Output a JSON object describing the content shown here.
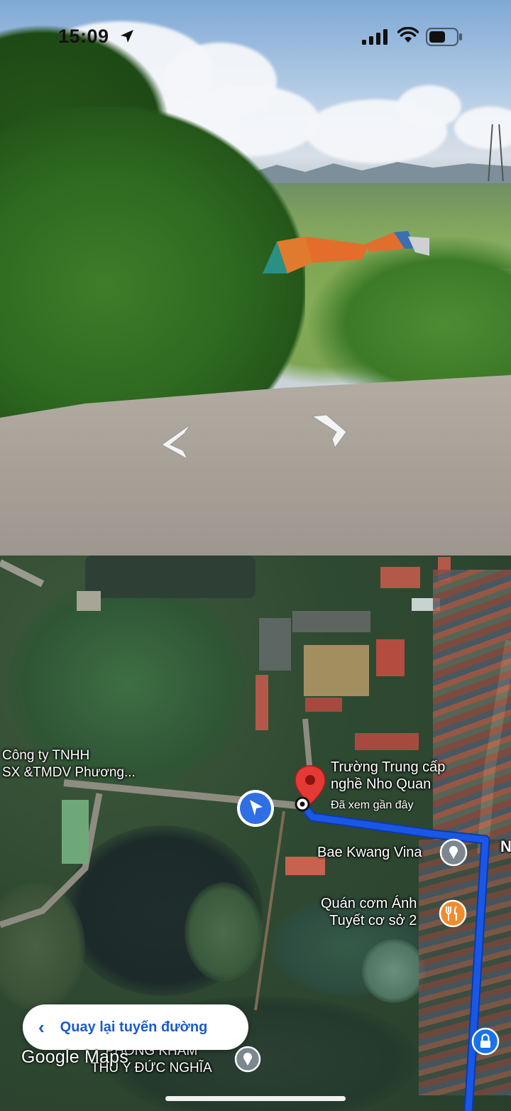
{
  "status_bar": {
    "time": "15:09",
    "icons": [
      "location-arrow-icon",
      "cellular-signal-icon",
      "wifi-icon",
      "battery-icon"
    ]
  },
  "street_view": {
    "controls": [
      "nav-arrow-back-icon",
      "nav-arrow-forward-icon"
    ]
  },
  "map": {
    "places": [
      {
        "name_line1": "Công ty TNHH",
        "name_line2": "SX &TMDV Phương..."
      },
      {
        "name_line1": "Trường Trung cấp",
        "name_line2": "nghề Nho Quan",
        "subtitle": "Đã xem gần đây"
      },
      {
        "name": "Bae Kwang Vina"
      },
      {
        "name_line1": "Quán cơm Ánh",
        "name_line2": "Tuyết cơ sở 2"
      },
      {
        "name_line1": "PHÒNG KHÁM",
        "name_line2": "THÚ Y ĐỨC NGHĨA"
      }
    ],
    "road_label": "N",
    "back_button_label": "Quay lại tuyến đường",
    "logo_text": "Google Maps",
    "colors": {
      "route": "#1a57e6",
      "pin": "#e53935",
      "accent": "#1a5cc8",
      "food_marker": "#f28b2c"
    }
  }
}
